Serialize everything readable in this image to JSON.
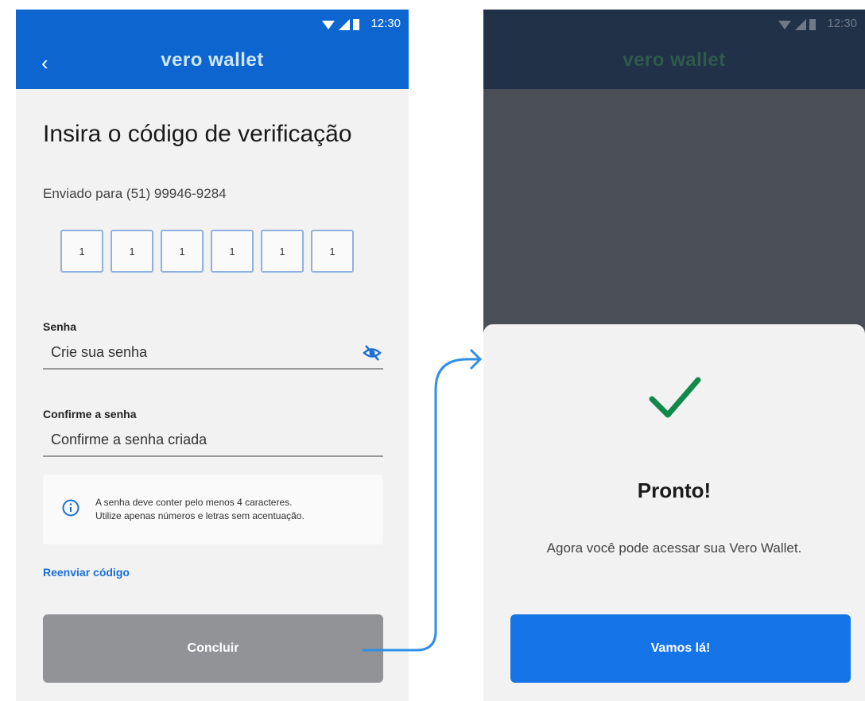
{
  "status": {
    "time": "12:30"
  },
  "app": {
    "logo": "vero wallet"
  },
  "verify": {
    "title": "Insira o código de verificação",
    "sent_to": "Enviado para (51) 99946-9284",
    "code_digits": [
      "1",
      "1",
      "1",
      "1",
      "1",
      "1"
    ],
    "password_label": "Senha",
    "password_placeholder": "Crie sua senha",
    "confirm_label": "Confirme a senha",
    "confirm_placeholder": "Confirme a senha criada",
    "info_line1": "A senha deve conter pelo menos 4 caracteres.",
    "info_line2": "Utilize apenas números e letras sem acentuação.",
    "resend_link": "Reenviar código",
    "submit_label": "Concluir"
  },
  "success": {
    "title": "Pronto!",
    "message": "Agora você pode acessar sua Vero Wallet.",
    "button_label": "Vamos lá!"
  },
  "icons": {
    "back": "chevron-left-icon",
    "eye": "eye-off-icon",
    "info": "info-icon",
    "check": "check-icon"
  },
  "colors": {
    "brand_blue": "#0d66d0",
    "accent_blue": "#1474e8",
    "check_green": "#0f8a4b",
    "disabled_button": "#919396"
  }
}
